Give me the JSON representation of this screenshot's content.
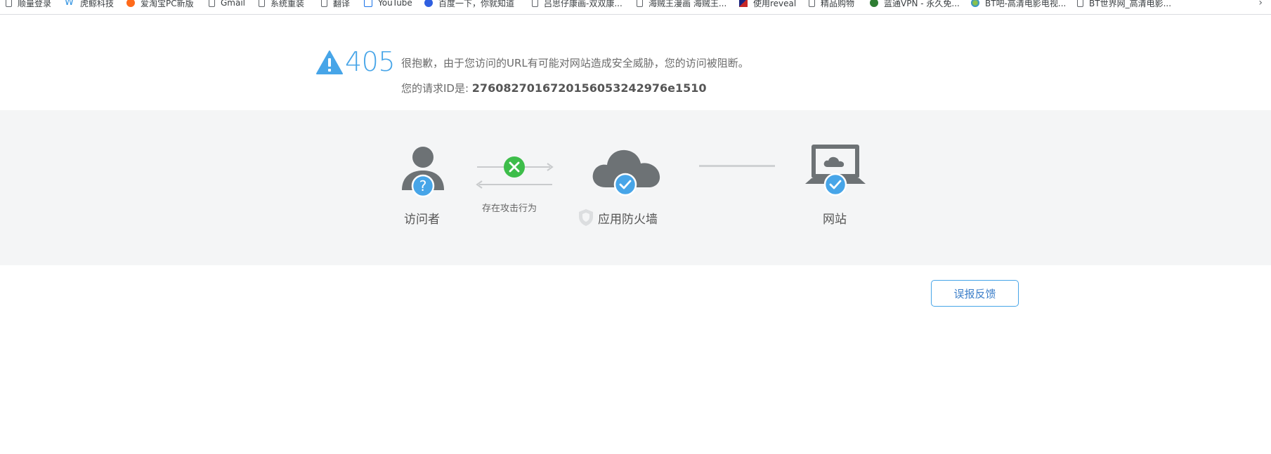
{
  "bookmarks": [
    {
      "label": "顺量登录",
      "icon": "page-icon"
    },
    {
      "label": "虎鲸科技",
      "icon": "brand-icon"
    },
    {
      "label": "爱淘宝PC新版",
      "icon": "taobao-icon"
    },
    {
      "label": "Gmail",
      "icon": "page-icon"
    },
    {
      "label": "系统重装",
      "icon": "page-icon"
    },
    {
      "label": "翻译",
      "icon": "page-icon"
    },
    {
      "label": "YouTube",
      "icon": "youtube-icon"
    },
    {
      "label": "百度一下，你就知道",
      "icon": "baidu-icon"
    },
    {
      "label": "吕思仔康画-双双康...",
      "icon": "page-icon"
    },
    {
      "label": "海贼王漫画 海贼王...",
      "icon": "page-icon"
    },
    {
      "label": "使用reveal",
      "icon": "flag-icon"
    },
    {
      "label": "精品购物",
      "icon": "page-icon"
    },
    {
      "label": "蓝通VPN - 永久免...",
      "icon": "vpn-icon"
    },
    {
      "label": "BT吧-高清电影电视...",
      "icon": "globe-icon"
    },
    {
      "label": "BT世界网_高清电影...",
      "icon": "page-icon"
    }
  ],
  "error": {
    "code": "405",
    "message": "很抱歉，由于您访问的URL有可能对网站造成安全威胁，您的访问被阻断。",
    "request_label": "您的请求ID是: ",
    "request_id": "27608270167201560532429​76e1510"
  },
  "flow": {
    "visitor_label": "访问者",
    "attack_label": "存在攻击行为",
    "firewall_label": "应用防火墙",
    "site_label": "网站"
  },
  "feedback_label": "误报反馈",
  "colors": {
    "accent": "#47a5e8",
    "success": "#3dbd4a",
    "icon_gray": "#6d7275",
    "band_bg": "#f4f5f6"
  }
}
